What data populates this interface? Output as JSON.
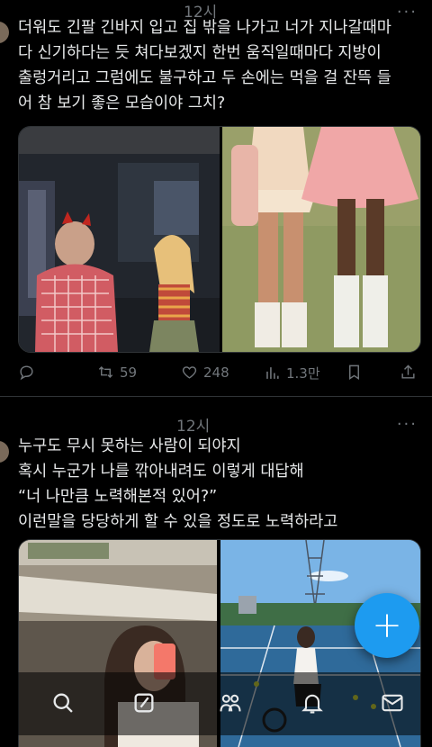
{
  "tweet1": {
    "time": "12시",
    "more": "···",
    "text": "더워도 긴팔 긴바지 입고 집 밖을 나가고 너가 지나갈때마\n다 신기하다는 듯 쳐다보겠지 한번 움직일때마다 지방이\n출렁거리고 그럼에도 불구하고 두 손에는 먹을 걸 잔뜩 들\n어 참 보기 좋은 모습이야 그치?",
    "retweets": "59",
    "likes": "248",
    "views": "1.3만"
  },
  "tweet2": {
    "time": "12시",
    "more": "···",
    "text": "누구도 무시 못하는 사람이 되야지\n혹시 누군가 나를 깎아내려도 이렇게 대답해\n“너 나만큼 노력해본적 있어?”\n이런말을 당당하게 할 수 있을 정도로 노력하라고"
  },
  "fab": {
    "label": "+"
  },
  "icons": [
    "reply-icon",
    "retweet-icon",
    "like-icon",
    "views-icon",
    "bookmark-icon",
    "share-icon",
    "search-icon",
    "edit-icon",
    "communities-icon",
    "notifications-icon",
    "messages-icon"
  ],
  "accent": "#1d9bf0"
}
